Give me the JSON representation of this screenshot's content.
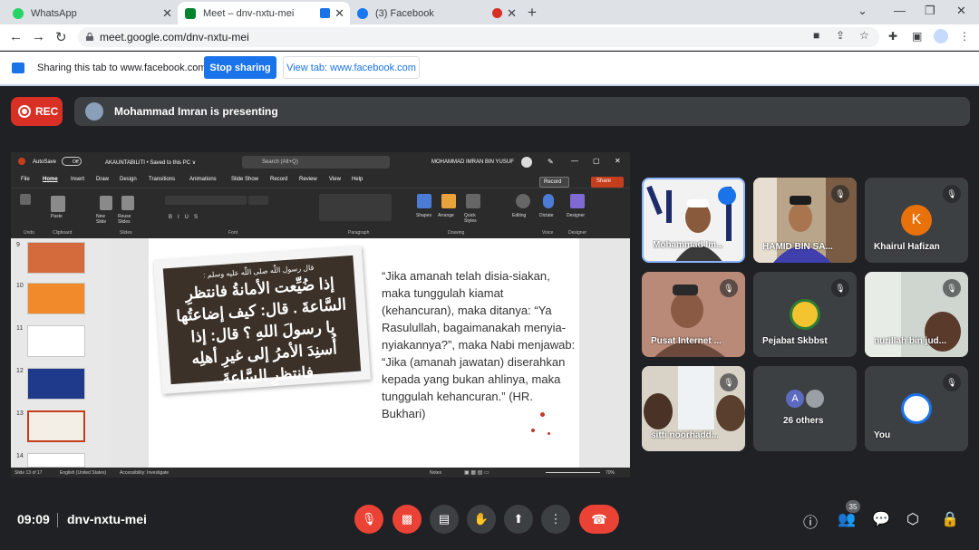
{
  "browser": {
    "tabs": [
      {
        "title": "WhatsApp",
        "favicon_color": "#25d366"
      },
      {
        "title": "Meet – dnv-nxtu-mei",
        "favicon_color": "#00832d"
      },
      {
        "title": "(3) Facebook",
        "favicon_color": "#1877f2"
      }
    ],
    "url": "meet.google.com/dnv-nxtu-mei"
  },
  "share_bar": {
    "text": "Sharing this tab to www.facebook.com",
    "stop_label": "Stop sharing",
    "view_label": "View tab: www.facebook.com"
  },
  "meet": {
    "rec_label": "REC",
    "presenting_text": "Mohammad Imran is presenting",
    "time": "09:09",
    "meeting_code": "dnv-nxtu-mei",
    "participant_count": "35"
  },
  "powerpoint": {
    "autosave": "AutoSave",
    "autosave_state": "Off",
    "file_title": "AKAUNTABILITI • Saved to this PC ∨",
    "search_placeholder": "Search (Alt+Q)",
    "user_name": "MOHAMMAD IMRAN BIN YUSUF",
    "menu": [
      "File",
      "Home",
      "Insert",
      "Draw",
      "Design",
      "Transitions",
      "Animations",
      "Slide Show",
      "Record",
      "Review",
      "View",
      "Help"
    ],
    "record_btn": "Record",
    "share_btn": "Share",
    "ribbon_groups": [
      "Undo",
      "Clipboard",
      "Slides",
      "Font",
      "Paragraph",
      "Drawing",
      "Voice",
      "Designer"
    ],
    "ribbon_buttons": [
      "Paste",
      "New Slide",
      "Reuse Slides",
      "Shapes",
      "Arrange",
      "Quick Styles",
      "Editing",
      "Dictate",
      "Designer"
    ],
    "thumb_numbers": [
      "9",
      "10",
      "11",
      "12",
      "13",
      "14"
    ],
    "status": {
      "slide": "Slide 13 of 17",
      "language": "English (United States)",
      "accessibility": "Accessibility: Investigate",
      "notes": "Notes",
      "zoom": "70%"
    },
    "slide": {
      "arabic_header": "قال رسول اللّٰه صلى اللّٰه عليه وسلم :",
      "arabic_body": "إذا ضُيِّعت الأمانةُ فانتظرِ السَّاعةَ . قال: كيف إضاعتُها يا رسولَ اللهِ ؟ قال: إذا أُسنِدَ الأمرُ إلى غيرِ أهلِه فانتظرِ السَّاعةَ.",
      "malay_text": "“Jika amanah telah disia-siakan, maka tunggulah kiamat (kehancuran), maka ditanya: “Ya Rasulullah, bagaimanakah menyia-nyiakannya?”, maka Nabi menjawab: “Jika (amanah jawatan) diserahkan kepada yang bukan ahlinya, maka tunggulah kehancuran.” (HR. Bukhari)"
    }
  },
  "participants": [
    {
      "name": "Mohammad Im...",
      "speaking": true,
      "muted": false,
      "tile": "video"
    },
    {
      "name": "HAMID BIN SA...",
      "speaking": false,
      "muted": true,
      "tile": "video"
    },
    {
      "name": "Khairul Hafizan",
      "speaking": false,
      "muted": true,
      "tile": "avatar",
      "initial": "K",
      "color": "#e8710a"
    },
    {
      "name": "Pusat Internet ...",
      "speaking": false,
      "muted": true,
      "tile": "video"
    },
    {
      "name": "Pejabat Skbbst",
      "speaking": false,
      "muted": true,
      "tile": "avatar"
    },
    {
      "name": "nurillah bin jud...",
      "speaking": false,
      "muted": true,
      "tile": "video"
    },
    {
      "name": "sitti noorhadd...",
      "speaking": false,
      "muted": true,
      "tile": "video"
    },
    {
      "name": "26 others",
      "speaking": false,
      "muted": false,
      "tile": "others",
      "initial": "A"
    },
    {
      "name": "You",
      "speaking": false,
      "muted": true,
      "tile": "avatar"
    }
  ],
  "colors": {
    "meet_bg": "#202124",
    "tile_bg": "#3c4043",
    "accent_blue": "#1a73e8",
    "hangup_red": "#ea4335",
    "ppt_accent": "#c43e1c"
  }
}
